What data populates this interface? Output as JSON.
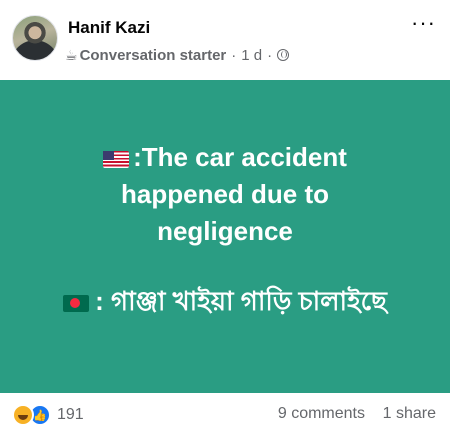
{
  "post": {
    "author": "Hanif Kazi",
    "badge_label": "Conversation starter",
    "time": "1 d",
    "separator": "·",
    "more_label": "···"
  },
  "card": {
    "background": "#2a9d83",
    "line1": ":The car accident",
    "line2": "happened due to",
    "line3": "negligence",
    "line4": ": গাঞ্জা খাইয়া গাড়ি চালাইছে"
  },
  "footer": {
    "reaction_count": "191",
    "comments_label": "9 comments",
    "shares_label": "1 share"
  }
}
